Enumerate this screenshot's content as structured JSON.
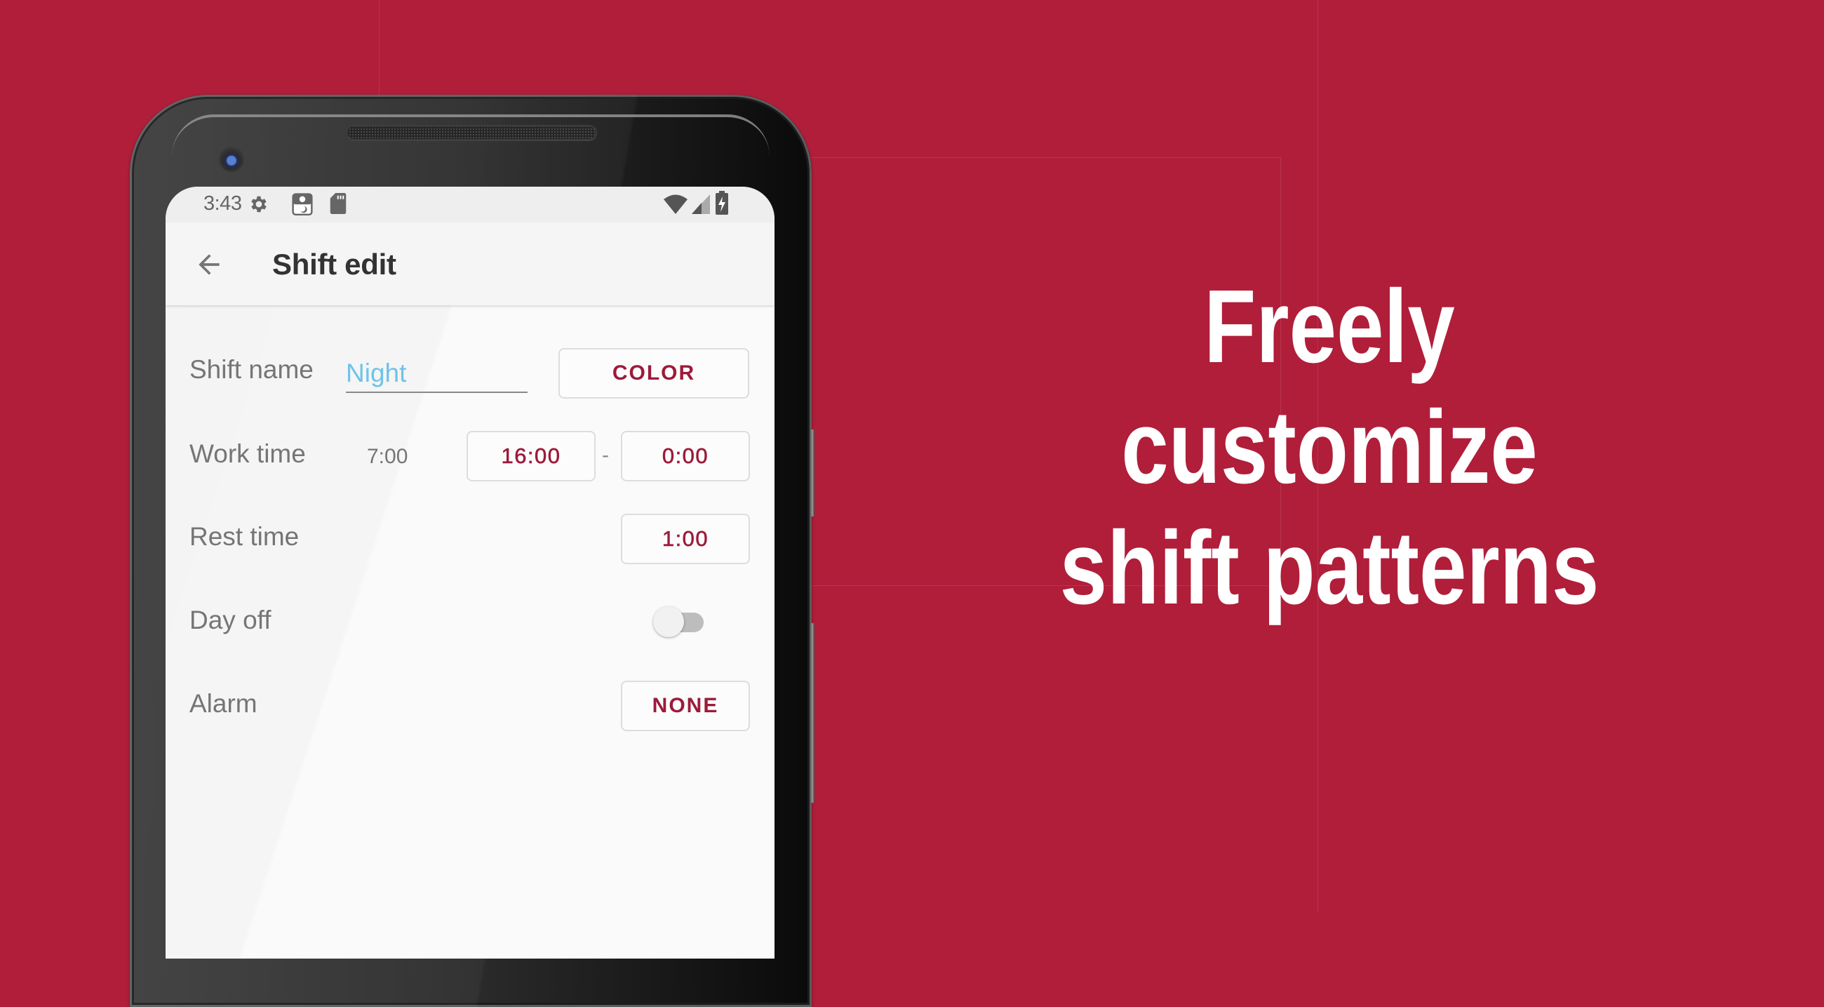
{
  "colors": {
    "background": "#B01E3A",
    "accent": "#9C1B3A",
    "input_text": "#6EC3E8",
    "label": "#757575"
  },
  "status_bar": {
    "time": "3:43",
    "left_icons": [
      "gear-icon",
      "calendar-day-night-icon",
      "sd-card-icon"
    ],
    "right_icons": [
      "wifi-icon",
      "cell-signal-icon",
      "battery-charging-icon"
    ]
  },
  "app_bar": {
    "back_icon": "arrow-back-icon",
    "title": "Shift edit"
  },
  "form": {
    "shift_name": {
      "label": "Shift name",
      "value": "Night",
      "color_button": "COLOR"
    },
    "work_time": {
      "label": "Work time",
      "duration": "7:00",
      "start": "16:00",
      "separator": "-",
      "end": "0:00"
    },
    "rest_time": {
      "label": "Rest time",
      "value": "1:00"
    },
    "day_off": {
      "label": "Day off",
      "enabled": false
    },
    "alarm": {
      "label": "Alarm",
      "value": "NONE"
    }
  },
  "headline": {
    "lines": [
      "Freely",
      "customize",
      "shift patterns"
    ]
  }
}
